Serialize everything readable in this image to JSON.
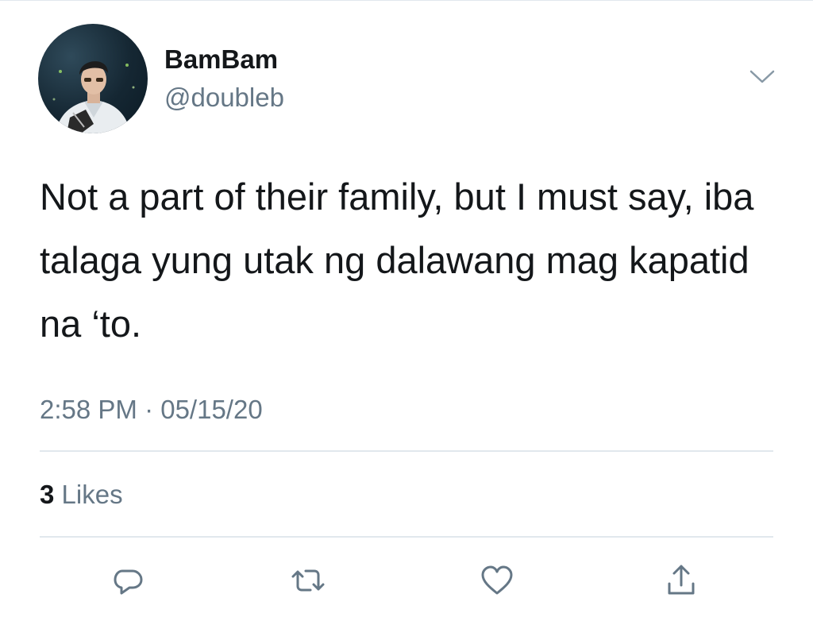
{
  "author": {
    "display_name": "BamBam",
    "handle": "@doubleb"
  },
  "tweet": {
    "text": "Not a part of their family, but I must say, iba talaga yung utak ng dalawang mag kapatid na ‘to.",
    "timestamp": "2:58 PM · 05/15/20"
  },
  "stats": {
    "likes_count": "3",
    "likes_label": "Likes"
  },
  "actions": [
    "reply-icon",
    "retweet-icon",
    "like-icon",
    "share-icon"
  ],
  "colors": {
    "text_primary": "#14171a",
    "text_secondary": "#657786",
    "divider": "#e1e8ed"
  }
}
